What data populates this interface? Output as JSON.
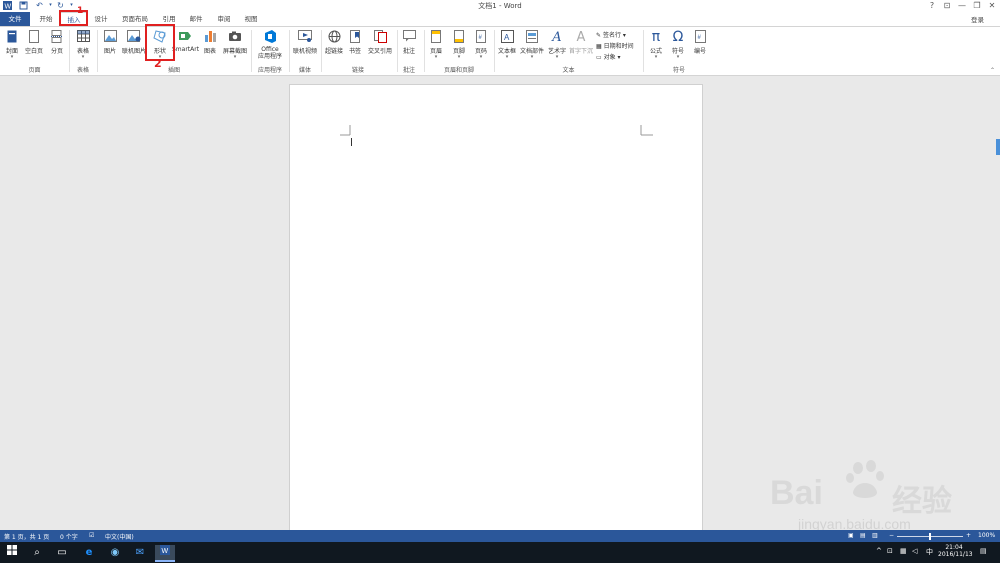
{
  "window": {
    "title": "文档1 - Word",
    "help": "?",
    "ribbon_toggle": "⊡",
    "minimize": "—",
    "restore": "❐",
    "close": "✕"
  },
  "tabs": [
    "文件",
    "开始",
    "插入",
    "设计",
    "页面布局",
    "引用",
    "邮件",
    "审阅",
    "视图"
  ],
  "active_tab": "插入",
  "account": {
    "login": "登录"
  },
  "ribbon": {
    "pages": {
      "cover": "封面",
      "blank": "空白页",
      "break": "分页",
      "label": "页面"
    },
    "tables": {
      "table": "表格",
      "label": "表格"
    },
    "illustrations": {
      "picture": "图片",
      "online_picture": "联机图片",
      "shapes": "形状",
      "smartart": "SmartArt",
      "chart": "图表",
      "screenshot": "屏幕截图",
      "label": "插图"
    },
    "apps": {
      "office_line1": "Office",
      "office_line2": "应用程序",
      "label": "应用程序"
    },
    "media": {
      "online_video": "联机视频",
      "label": "媒体"
    },
    "links": {
      "hyperlink": "超链接",
      "bookmark": "书签",
      "cross_ref": "交叉引用",
      "label": "链接"
    },
    "comments": {
      "comment": "批注",
      "label": "批注"
    },
    "header_footer": {
      "header": "页眉",
      "footer": "页脚",
      "page_number": "页码",
      "label": "页眉和页脚"
    },
    "text": {
      "textbox": "文本框",
      "quick_parts": "文档部件",
      "wordart": "艺术字",
      "dropcap": "首字下沉",
      "signature": "签名行",
      "datetime": "日期和时间",
      "object": "对象",
      "label": "文本"
    },
    "symbols": {
      "equation": "公式",
      "symbol": "符号",
      "number": "编号",
      "label": "符号"
    }
  },
  "annotations": {
    "step1": "1",
    "step2": "2"
  },
  "status": {
    "page": "第 1 页，共 1 页",
    "words": "0 个字",
    "language": "中文(中国)",
    "zoom": "100%"
  },
  "taskbar": {
    "time": "21:04",
    "date": "2016/11/13",
    "ime": "中"
  },
  "watermark": {
    "brand": "Bai",
    "brand_cn": "经验",
    "url": "jingyan.baidu.com"
  },
  "colors": {
    "accent": "#2b579a",
    "annotation": "#e02020",
    "taskbar": "#101820"
  }
}
